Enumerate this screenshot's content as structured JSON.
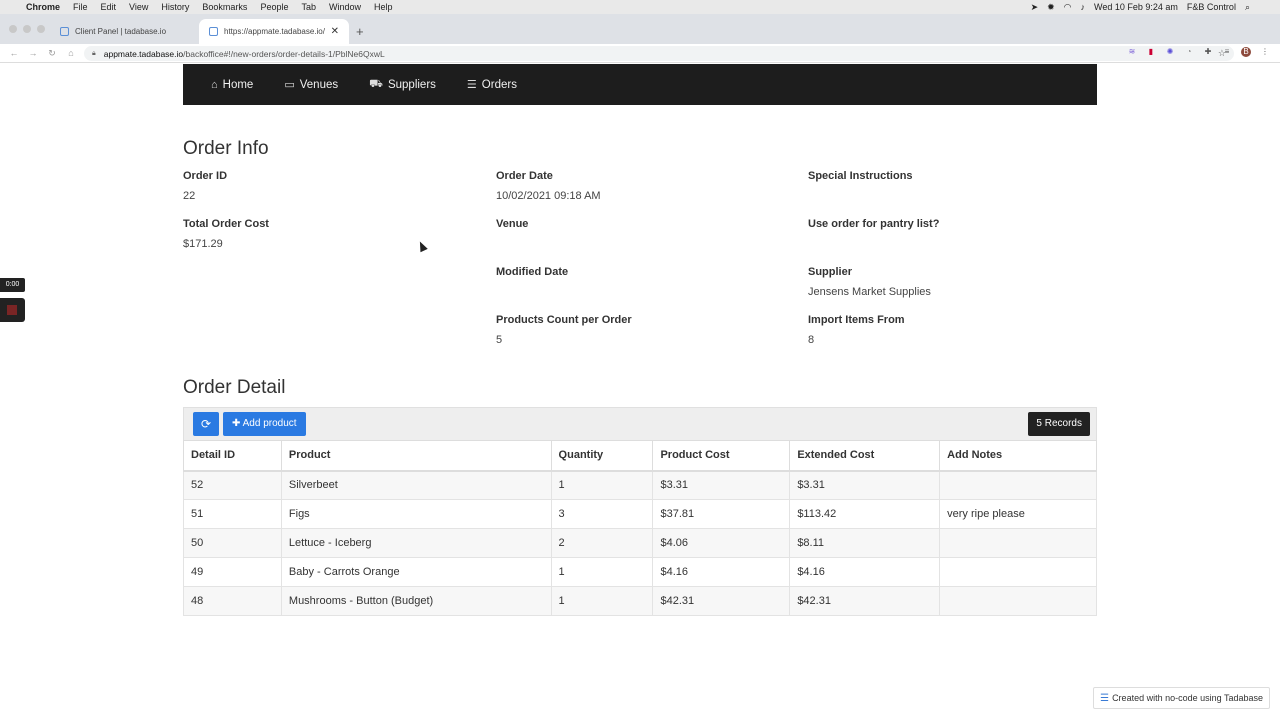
{
  "menubar": {
    "app": "Chrome",
    "items": [
      "File",
      "Edit",
      "View",
      "History",
      "Bookmarks",
      "People",
      "Tab",
      "Window",
      "Help"
    ],
    "clock": "Wed 10 Feb  9:24 am",
    "right_label": "F&B Control"
  },
  "tabs": [
    {
      "title": "Client Panel | tadabase.io"
    },
    {
      "title": "https://appmate.tadabase.io/b"
    }
  ],
  "address": {
    "host": "appmate.tadabase.io",
    "path": "/backoffice#!/new-orders/order-details-1/PblNe6QxwL"
  },
  "profile_initial": "B",
  "nav": {
    "items": [
      {
        "label": "Home",
        "icon": "home-icon"
      },
      {
        "label": "Venues",
        "icon": "venues-icon"
      },
      {
        "label": "Suppliers",
        "icon": "truck-icon"
      },
      {
        "label": "Orders",
        "icon": "list-icon"
      }
    ]
  },
  "order_info": {
    "title": "Order Info",
    "order_id_label": "Order ID",
    "order_id": "22",
    "total_cost_label": "Total Order Cost",
    "total_cost": "$171.29",
    "order_date_label": "Order Date",
    "order_date": "10/02/2021 09:18 AM",
    "venue_label": "Venue",
    "venue": "",
    "modified_date_label": "Modified Date",
    "modified_date": "",
    "products_count_label": "Products Count per Order",
    "products_count": "5",
    "special_instructions_label": "Special Instructions",
    "special_instructions": "",
    "pantry_label": "Use order for pantry list?",
    "pantry": "",
    "supplier_label": "Supplier",
    "supplier": "Jensens Market Supplies",
    "import_label": "Import Items From",
    "import_from": "8"
  },
  "order_detail": {
    "title": "Order Detail",
    "add_button": "Add product",
    "records": "5 Records",
    "columns": [
      "Detail ID",
      "Product",
      "Quantity",
      "Product Cost",
      "Extended Cost",
      "Add Notes"
    ],
    "rows": [
      [
        "52",
        "Silverbeet",
        "1",
        "$3.31",
        "$3.31",
        ""
      ],
      [
        "51",
        "Figs",
        "3",
        "$37.81",
        "$113.42",
        "very ripe please"
      ],
      [
        "50",
        "Lettuce - Iceberg",
        "2",
        "$4.06",
        "$8.11",
        ""
      ],
      [
        "49",
        "Baby - Carrots Orange",
        "1",
        "$4.16",
        "$4.16",
        ""
      ],
      [
        "48",
        "Mushrooms - Button (Budget)",
        "1",
        "$42.31",
        "$42.31",
        ""
      ]
    ]
  },
  "timer": "0:00",
  "footer": "Created with no-code using Tadabase"
}
